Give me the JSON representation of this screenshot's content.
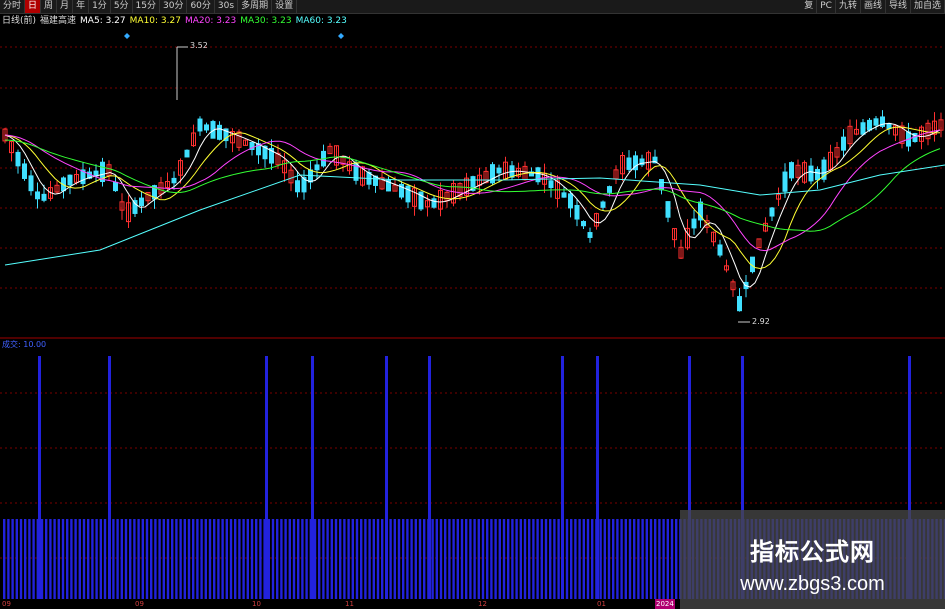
{
  "toolbar": {
    "left_items": [
      {
        "label": "分时",
        "active": false
      },
      {
        "label": "日",
        "active": true
      },
      {
        "label": "周",
        "active": false
      },
      {
        "label": "月",
        "active": false
      },
      {
        "label": "年",
        "active": false
      },
      {
        "label": "1分",
        "active": false
      },
      {
        "label": "5分",
        "active": false
      },
      {
        "label": "15分",
        "active": false
      },
      {
        "label": "30分",
        "active": false
      },
      {
        "label": "60分",
        "active": false
      },
      {
        "label": "30s",
        "active": false
      },
      {
        "label": "多周期",
        "active": false
      },
      {
        "label": "设置",
        "active": false
      }
    ],
    "right_items": [
      {
        "label": "复"
      },
      {
        "label": "PC"
      },
      {
        "label": "九转"
      },
      {
        "label": "画线"
      },
      {
        "label": "导线"
      },
      {
        "label": "加自选"
      }
    ]
  },
  "indicator_bar": {
    "period": "日线(前)",
    "name": "福建高速",
    "ma5": "MA5: 3.27",
    "ma10": "MA10: 3.27",
    "ma20": "MA20: 3.23",
    "ma30": "MA30: 3.23",
    "ma60": "MA60: 3.23",
    "colors": {
      "ma5": "#ffffff",
      "ma10": "#ffff33",
      "ma20": "#ff44ff",
      "ma30": "#33ff33",
      "ma60": "#55ffff"
    }
  },
  "price_marks": {
    "high": "3.52",
    "low": "2.92"
  },
  "volume_label": "成交: 10.00",
  "x_axis": [
    {
      "label": "09",
      "highlight": false
    },
    {
      "label": "09",
      "highlight": false
    },
    {
      "label": "10",
      "highlight": false
    },
    {
      "label": "11",
      "highlight": false
    },
    {
      "label": "12",
      "highlight": false
    },
    {
      "label": "01",
      "highlight": false
    },
    {
      "label": "2024",
      "highlight": true
    }
  ],
  "watermark": {
    "title": "指标公式网",
    "url": "www.zbgs3.com"
  },
  "colors": {
    "up": "#ff3030",
    "down": "#40e0ff",
    "grid": "#7a0000",
    "volume": "#2222dd"
  }
}
